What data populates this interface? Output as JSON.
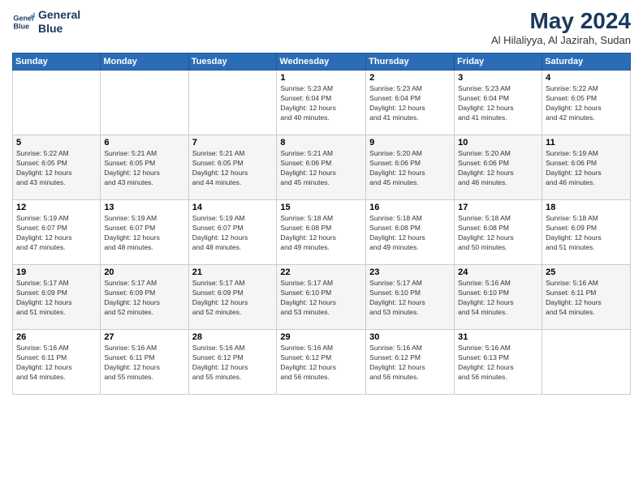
{
  "logo": {
    "line1": "General",
    "line2": "Blue"
  },
  "title": {
    "month_year": "May 2024",
    "location": "Al Hilaliyya, Al Jazirah, Sudan"
  },
  "headers": [
    "Sunday",
    "Monday",
    "Tuesday",
    "Wednesday",
    "Thursday",
    "Friday",
    "Saturday"
  ],
  "weeks": [
    [
      {
        "day": "",
        "info": ""
      },
      {
        "day": "",
        "info": ""
      },
      {
        "day": "",
        "info": ""
      },
      {
        "day": "1",
        "info": "Sunrise: 5:23 AM\nSunset: 6:04 PM\nDaylight: 12 hours\nand 40 minutes."
      },
      {
        "day": "2",
        "info": "Sunrise: 5:23 AM\nSunset: 6:04 PM\nDaylight: 12 hours\nand 41 minutes."
      },
      {
        "day": "3",
        "info": "Sunrise: 5:23 AM\nSunset: 6:04 PM\nDaylight: 12 hours\nand 41 minutes."
      },
      {
        "day": "4",
        "info": "Sunrise: 5:22 AM\nSunset: 6:05 PM\nDaylight: 12 hours\nand 42 minutes."
      }
    ],
    [
      {
        "day": "5",
        "info": "Sunrise: 5:22 AM\nSunset: 6:05 PM\nDaylight: 12 hours\nand 43 minutes."
      },
      {
        "day": "6",
        "info": "Sunrise: 5:21 AM\nSunset: 6:05 PM\nDaylight: 12 hours\nand 43 minutes."
      },
      {
        "day": "7",
        "info": "Sunrise: 5:21 AM\nSunset: 6:05 PM\nDaylight: 12 hours\nand 44 minutes."
      },
      {
        "day": "8",
        "info": "Sunrise: 5:21 AM\nSunset: 6:06 PM\nDaylight: 12 hours\nand 45 minutes."
      },
      {
        "day": "9",
        "info": "Sunrise: 5:20 AM\nSunset: 6:06 PM\nDaylight: 12 hours\nand 45 minutes."
      },
      {
        "day": "10",
        "info": "Sunrise: 5:20 AM\nSunset: 6:06 PM\nDaylight: 12 hours\nand 46 minutes."
      },
      {
        "day": "11",
        "info": "Sunrise: 5:19 AM\nSunset: 6:06 PM\nDaylight: 12 hours\nand 46 minutes."
      }
    ],
    [
      {
        "day": "12",
        "info": "Sunrise: 5:19 AM\nSunset: 6:07 PM\nDaylight: 12 hours\nand 47 minutes."
      },
      {
        "day": "13",
        "info": "Sunrise: 5:19 AM\nSunset: 6:07 PM\nDaylight: 12 hours\nand 48 minutes."
      },
      {
        "day": "14",
        "info": "Sunrise: 5:19 AM\nSunset: 6:07 PM\nDaylight: 12 hours\nand 48 minutes."
      },
      {
        "day": "15",
        "info": "Sunrise: 5:18 AM\nSunset: 6:08 PM\nDaylight: 12 hours\nand 49 minutes."
      },
      {
        "day": "16",
        "info": "Sunrise: 5:18 AM\nSunset: 6:08 PM\nDaylight: 12 hours\nand 49 minutes."
      },
      {
        "day": "17",
        "info": "Sunrise: 5:18 AM\nSunset: 6:08 PM\nDaylight: 12 hours\nand 50 minutes."
      },
      {
        "day": "18",
        "info": "Sunrise: 5:18 AM\nSunset: 6:09 PM\nDaylight: 12 hours\nand 51 minutes."
      }
    ],
    [
      {
        "day": "19",
        "info": "Sunrise: 5:17 AM\nSunset: 6:09 PM\nDaylight: 12 hours\nand 51 minutes."
      },
      {
        "day": "20",
        "info": "Sunrise: 5:17 AM\nSunset: 6:09 PM\nDaylight: 12 hours\nand 52 minutes."
      },
      {
        "day": "21",
        "info": "Sunrise: 5:17 AM\nSunset: 6:09 PM\nDaylight: 12 hours\nand 52 minutes."
      },
      {
        "day": "22",
        "info": "Sunrise: 5:17 AM\nSunset: 6:10 PM\nDaylight: 12 hours\nand 53 minutes."
      },
      {
        "day": "23",
        "info": "Sunrise: 5:17 AM\nSunset: 6:10 PM\nDaylight: 12 hours\nand 53 minutes."
      },
      {
        "day": "24",
        "info": "Sunrise: 5:16 AM\nSunset: 6:10 PM\nDaylight: 12 hours\nand 54 minutes."
      },
      {
        "day": "25",
        "info": "Sunrise: 5:16 AM\nSunset: 6:11 PM\nDaylight: 12 hours\nand 54 minutes."
      }
    ],
    [
      {
        "day": "26",
        "info": "Sunrise: 5:16 AM\nSunset: 6:11 PM\nDaylight: 12 hours\nand 54 minutes."
      },
      {
        "day": "27",
        "info": "Sunrise: 5:16 AM\nSunset: 6:11 PM\nDaylight: 12 hours\nand 55 minutes."
      },
      {
        "day": "28",
        "info": "Sunrise: 5:16 AM\nSunset: 6:12 PM\nDaylight: 12 hours\nand 55 minutes."
      },
      {
        "day": "29",
        "info": "Sunrise: 5:16 AM\nSunset: 6:12 PM\nDaylight: 12 hours\nand 56 minutes."
      },
      {
        "day": "30",
        "info": "Sunrise: 5:16 AM\nSunset: 6:12 PM\nDaylight: 12 hours\nand 56 minutes."
      },
      {
        "day": "31",
        "info": "Sunrise: 5:16 AM\nSunset: 6:13 PM\nDaylight: 12 hours\nand 56 minutes."
      },
      {
        "day": "",
        "info": ""
      }
    ]
  ]
}
